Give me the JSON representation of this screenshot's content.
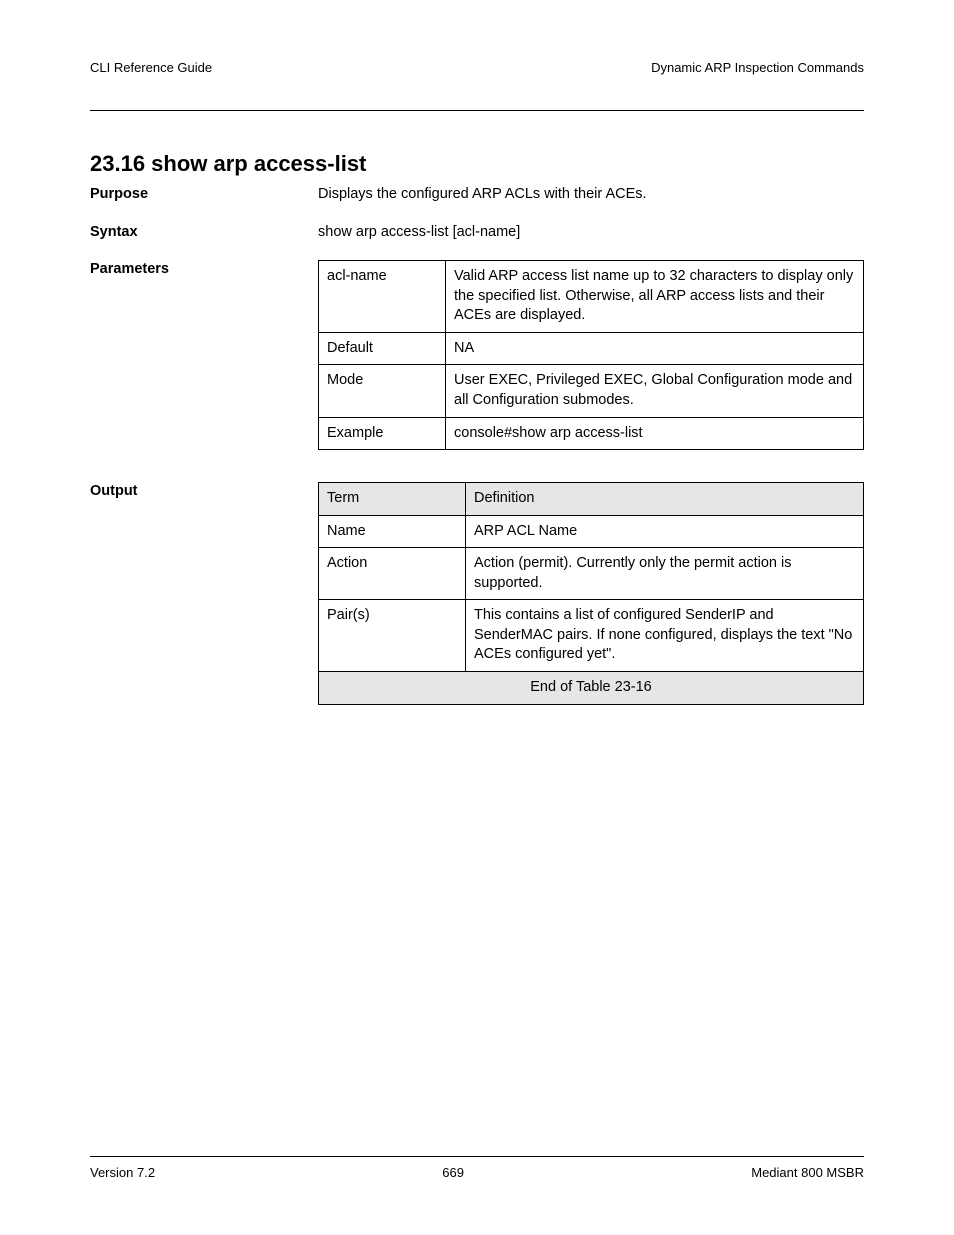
{
  "header": {
    "left": "CLI Reference Guide",
    "right": "Dynamic ARP Inspection Commands"
  },
  "section_title": "23.16 show arp access-list",
  "purpose_label": "Purpose",
  "purpose_text": "Displays the configured ARP ACLs with their ACEs.",
  "syntax_label": "Syntax",
  "syntax_text": "show arp access-list [acl-name]",
  "parameters_label": "Parameters",
  "t1": {
    "r1c1": "acl-name",
    "r1c2": "Valid ARP access list name up to 32 characters to display only the specified list. Otherwise, all ARP access lists and their ACEs are displayed.",
    "r2c1": "Default",
    "r2c2": "NA",
    "r3c1": "Mode",
    "r3c2": "User EXEC, Privileged EXEC, Global Configuration mode and all Configuration submodes.",
    "r4c1": "Example",
    "r4c2": "console#show arp access-list"
  },
  "output_label": "Output",
  "t2": {
    "h1": "Term",
    "h2": "Definition",
    "r1c1": "Name",
    "r1c2": "ARP ACL Name",
    "r2c1": "Action",
    "r2c2": "Action (permit). Currently only the  permit action is supported.",
    "r3c1": "Pair(s)",
    "r3c2": "This contains a list of configured SenderIP and SenderMAC pairs. If none configured, displays the text \"No ACEs configured yet\".",
    "footer": "End of Table 23-16"
  },
  "footer": {
    "left": "Version 7.2",
    "center": "669",
    "right": "Mediant 800 MSBR"
  }
}
